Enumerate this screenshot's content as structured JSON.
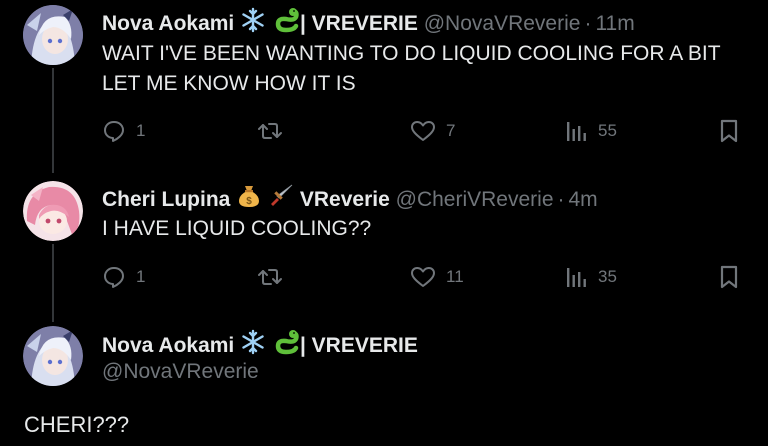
{
  "colors": {
    "background": "#000000",
    "text": "#e7e9ea",
    "muted": "#71767b",
    "thread_line": "#333639"
  },
  "tweets": [
    {
      "name": "Nova Aokami",
      "name_suffix": "| VREVERIE",
      "emojis": [
        "snowflake-emoji",
        "snake-emoji"
      ],
      "handle": "@NovaVReverie",
      "separator": "·",
      "time": "11m",
      "text_lines": [
        "WAIT I'VE BEEN WANTING TO DO LIQUID COOLING FOR A BIT",
        "LET ME KNOW HOW IT IS"
      ],
      "replies": "1",
      "retweets": "",
      "likes": "7",
      "views": "55"
    },
    {
      "name": "Cheri Lupina",
      "name_suffix": "VReverie",
      "emojis": [
        "money-bag-emoji",
        "dagger-emoji"
      ],
      "handle": "@CheriVReverie",
      "separator": "·",
      "time": "4m",
      "text_lines": [
        "I HAVE LIQUID COOLING??"
      ],
      "replies": "1",
      "retweets": "",
      "likes": "11",
      "views": "35"
    },
    {
      "name": "Nova Aokami",
      "name_suffix": "| VREVERIE",
      "emojis": [
        "snowflake-emoji",
        "snake-emoji"
      ],
      "handle": "@NovaVReverie",
      "text_lines": [
        "CHERI???"
      ]
    }
  ]
}
